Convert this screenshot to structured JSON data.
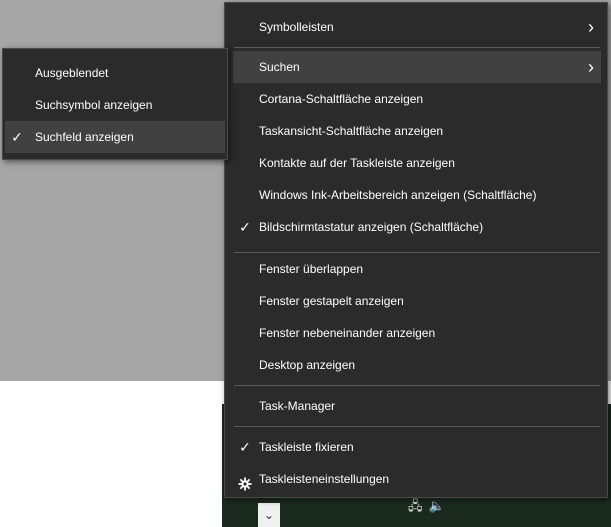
{
  "main_menu": {
    "items": [
      {
        "label": "Symbolleisten",
        "has_submenu": true
      },
      {
        "label": "Suchen",
        "has_submenu": true
      },
      {
        "label": "Cortana-Schaltfläche anzeigen"
      },
      {
        "label": "Taskansicht-Schaltfläche anzeigen"
      },
      {
        "label": "Kontakte auf der Taskleiste anzeigen"
      },
      {
        "label": "Windows Ink-Arbeitsbereich anzeigen (Schaltfläche)"
      },
      {
        "label": "Bildschirmtastatur anzeigen (Schaltfläche)",
        "checked": true
      },
      {
        "label": "Fenster überlappen"
      },
      {
        "label": "Fenster gestapelt anzeigen"
      },
      {
        "label": "Fenster nebeneinander anzeigen"
      },
      {
        "label": "Desktop anzeigen"
      },
      {
        "label": "Task-Manager"
      },
      {
        "label": "Taskleiste fixieren",
        "checked": true
      },
      {
        "label": "Taskleisteneinstellungen",
        "icon": "gear-icon"
      }
    ]
  },
  "sub_menu": {
    "items": [
      {
        "label": "Ausgeblendet"
      },
      {
        "label": "Suchsymbol anzeigen"
      },
      {
        "label": "Suchfeld anzeigen",
        "checked": true
      }
    ]
  },
  "icons": {
    "check": "checkmark-icon",
    "chevron": "chevron-right-icon",
    "gear": "gear-icon",
    "taskbar_chevron": "chevron-down-icon",
    "tray_network": "network-icon",
    "tray_volume": "volume-icon"
  },
  "colors": {
    "menu_bg": "#2b2b2b",
    "highlight": "#414141",
    "separator": "#5a5a5a",
    "text": "#ffffff",
    "desktop": "#a6a6a6"
  }
}
